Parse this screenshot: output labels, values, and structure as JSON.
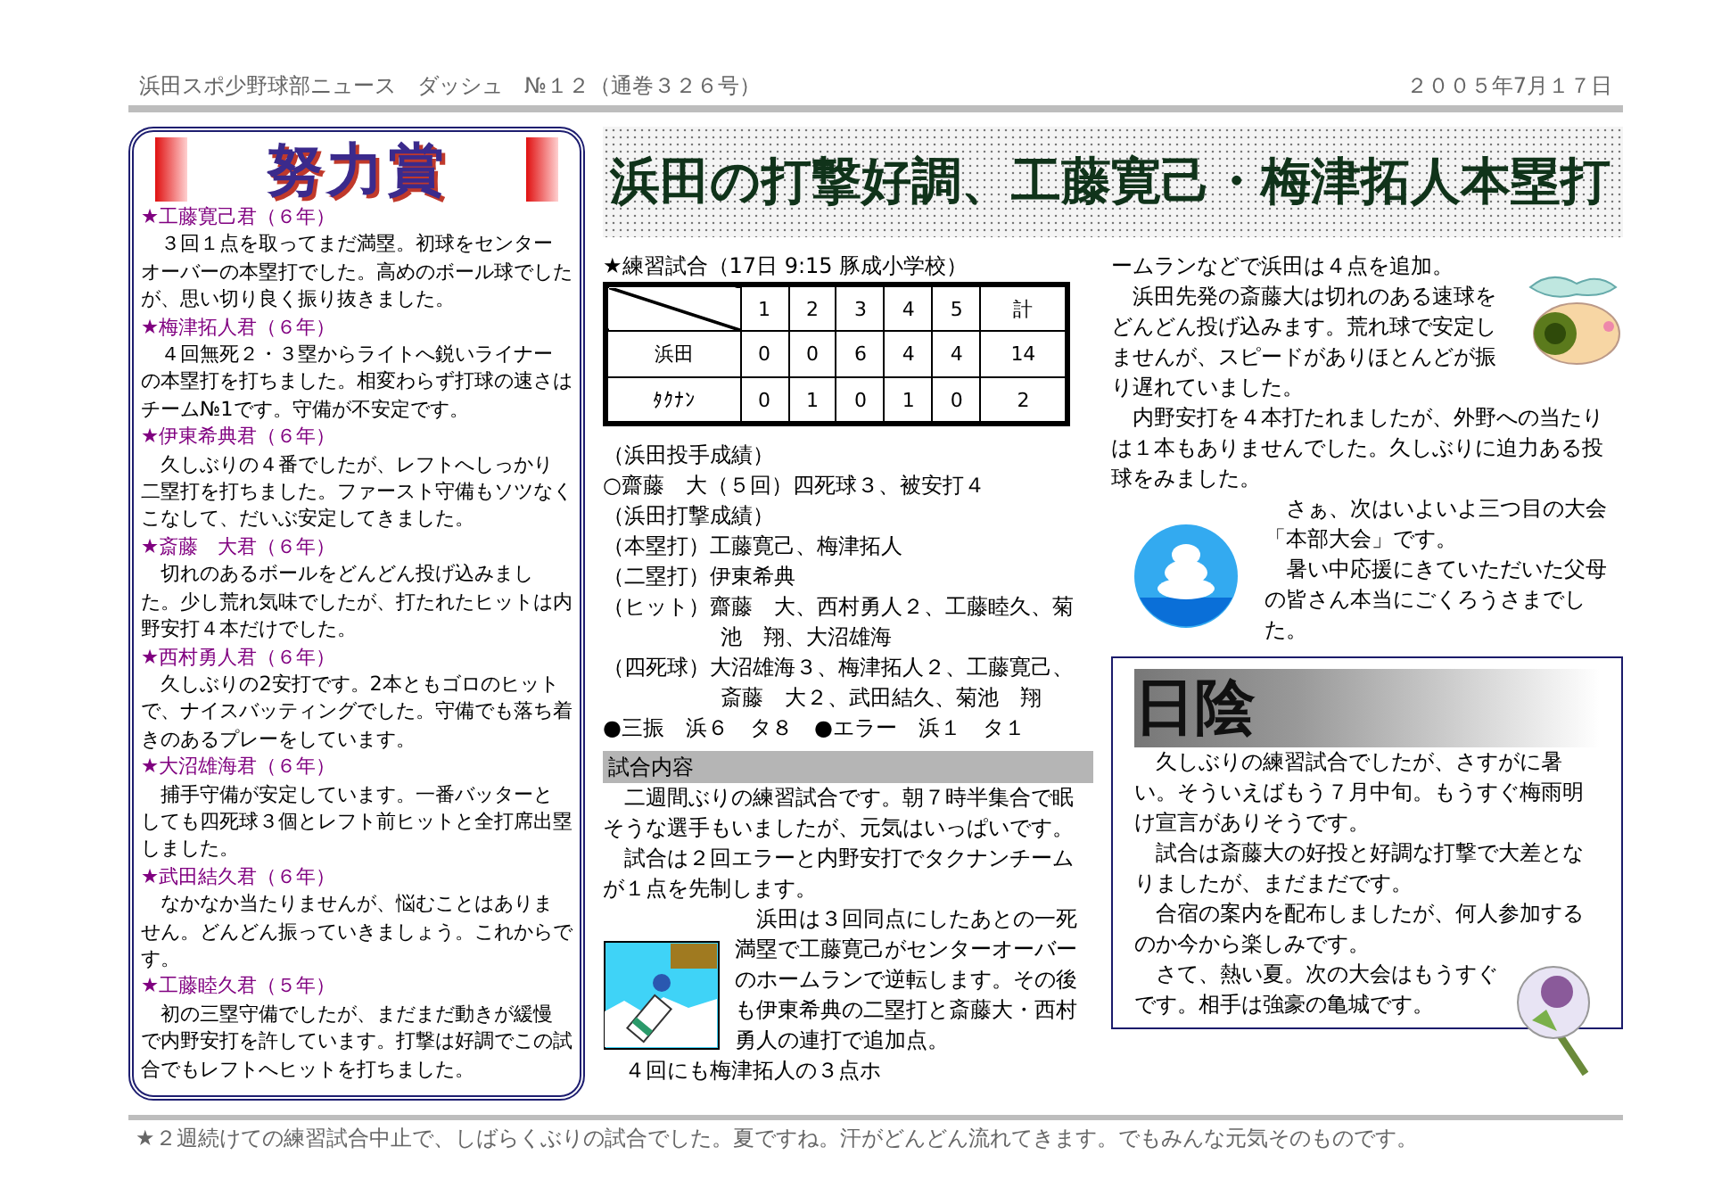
{
  "header": {
    "newsletter": "浜田スポ少野球部ニュース　ダッシュ　№１２（通巻３２６号）",
    "date": "２００５年7月１７日"
  },
  "award": {
    "title": "努力賞",
    "entries": [
      {
        "name": "★工藤寛己君（６年）",
        "text": "３回１点を取ってまだ満塁。初球をセンターオーバーの本塁打でした。高めのボール球でしたが、思い切り良く振り抜きました。"
      },
      {
        "name": "★梅津拓人君（６年）",
        "text": "４回無死２・３塁からライトへ鋭いライナーの本塁打を打ちました。相変わらず打球の速さはチーム№1です。守備が不安定です。"
      },
      {
        "name": "★伊東希典君（６年）",
        "text": "久しぶりの４番でしたが、レフトへしっかり二塁打を打ちました。ファースト守備もソツなくこなして、だいぶ安定してきました。"
      },
      {
        "name": "★斎藤　大君（６年）",
        "text": "切れのあるボールをどんどん投げ込みました。少し荒れ気味でしたが、打たれたヒットは内野安打４本だけでした。"
      },
      {
        "name": "★西村勇人君（６年）",
        "text": "久しぶりの2安打です。2本ともゴロのヒットで、ナイスバッティングでした。守備でも落ち着きのあるプレーをしています。"
      },
      {
        "name": "★大沼雄海君（６年）",
        "text": "捕手守備が安定しています。一番バッターとしても四死球３個とレフト前ヒットと全打席出塁しました。"
      },
      {
        "name": "★武田結久君（６年）",
        "text": "なかなか当たりませんが、悩むことはありません。どんどん振っていきましょう。これからです。"
      },
      {
        "name": "★工藤睦久君（５年）",
        "text": "初の三塁守備でしたが、まだまだ動きが緩慢で内野安打を許しています。打撃は好調でこの試合でもレフトへヒットを打ちました。"
      }
    ]
  },
  "headline": "浜田の打撃好調、工藤寛己・梅津拓人本塁打",
  "game": {
    "caption": "★練習試合（17日 9:15 豚成小学校）",
    "scoreboard": {
      "columns": [
        "1",
        "2",
        "3",
        "4",
        "5",
        "計"
      ],
      "rows": [
        {
          "team": "浜田",
          "cells": [
            "0",
            "0",
            "6",
            "4",
            "4",
            "14"
          ]
        },
        {
          "team": "ﾀｸﾅﾝ",
          "cells": [
            "0",
            "1",
            "0",
            "1",
            "0",
            "2"
          ]
        }
      ]
    },
    "results": [
      {
        "label": "（浜田投手成績）"
      },
      {
        "label": "○齋藤　大（５回）四死球３、被安打４"
      },
      {
        "label": "（浜田打撃成績）"
      },
      {
        "label": "（本塁打）",
        "text": "工藤寛己、梅津拓人"
      },
      {
        "label": "（二塁打）",
        "text": "伊東希典"
      },
      {
        "label": "（ヒット）",
        "text": "齋藤　大、西村勇人２、工藤睦久、菊池　翔、大沼雄海"
      },
      {
        "label": "（四死球）",
        "text": "大沼雄海３、梅津拓人２、工藤寛己、斎藤　大２、武田結久、菊池　翔"
      },
      {
        "label": "●三振　浜６　タ８　●エラー　浜１　タ１"
      }
    ],
    "section_title": "試合内容",
    "paragraphs": [
      "二週間ぶりの練習試合です。朝７時半集合で眠そうな選手もいましたが、元気はいっぱいです。",
      "試合は２回エラーと内野安打でタクナンチームが１点を先制します。",
      "浜田は３回同点にしたあとの一死満塁で工藤寛己がセンターオーバーのホームランで逆転します。その後も伊東希典の二塁打と斎藤大・西村勇人の連打で追加点。",
      "４回にも梅津拓人の３点ホ"
    ]
  },
  "report_continued": {
    "continuation": "ームランなどで浜田は４点を追加。",
    "paragraphs": [
      "浜田先発の斎藤大は切れのある速球をどんどん投げ込みます。荒れ球で安定しませんが、スピードがありほとんどが振り遅れていました。",
      "内野安打を４本打たれましたが、外野への当たりは１本もありませんでした。久しぶりに迫力ある投球をみました。",
      "さぁ、次はいよいよ三つ目の大会「本部大会」です。",
      "暑い中応援にきていただいた父母の皆さん本当にごくろうさまでした。"
    ]
  },
  "column": {
    "title": "日陰",
    "paragraphs": [
      "久しぶりの練習試合でしたが、さすがに暑い。そういえばもう７月中旬。もうすぐ梅雨明け宣言がありそうです。",
      "試合は斎藤大の好投と好調な打撃で大差となりましたが、まだまだです。",
      "合宿の案内を配布しましたが、何人参加するのか今から楽しみです。",
      "さて、熱い夏。次の大会はもうすぐです。相手は強豪の亀城です。"
    ]
  },
  "footer": "★２週続けての練習試合中止で、しばらくぶりの試合でした。夏ですね。汗がどんどん流れてきます。でもみんな元気そのものです。"
}
